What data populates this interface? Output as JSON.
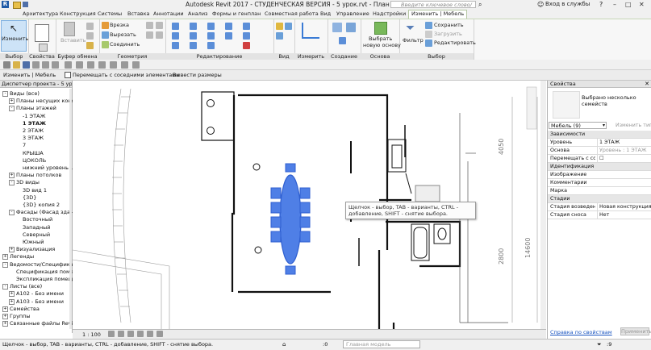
{
  "titlebar": {
    "title": "Autodesk Revit 2017 - СТУДЕНЧЕСКАЯ ВЕРСИЯ -  5 урок.rvt - План этажа: 1 ЭТАЖ",
    "search_placeholder": "Введите ключевое слово/фразу",
    "login": "Вход в службы"
  },
  "tabs": [
    "Архитектура",
    "Конструкция",
    "Системы",
    "Вставка",
    "Аннотации",
    "Анализ",
    "Формы и генплан",
    "Совместная работа",
    "Вид",
    "Управление",
    "Надстройки",
    "Изменить | Мебель"
  ],
  "active_tab_index": 11,
  "ribbon": {
    "modify_label": "Изменить",
    "select_group": "Выбор",
    "properties_group": "Свойства",
    "clipboard_insert": "Вставить",
    "clipboard_group": "Буфер обмена",
    "geometry_cut": "Врезка",
    "geometry_trim": "Вырезать",
    "geometry_join": "Соединить",
    "geometry_group": "Геометрия",
    "modify_group": "Редактирование",
    "view_group": "Вид",
    "measure_group": "Измерить",
    "create_group": "Создание",
    "pick_host_line1": "Выбрать",
    "pick_host_line2": "новую основу",
    "host_group": "Основа",
    "filter": "Фильтр",
    "save_sel": "Сохранить",
    "load_sel": "Загрузить",
    "edit_sel": "Редактировать",
    "selection_group": "Выбор"
  },
  "optbar": {
    "context": "Изменить | Мебель",
    "move_with_nearby": "Перемещать с соседними элементами",
    "free_dimensions": "Вывести размеры"
  },
  "project_browser": {
    "header": "Диспетчер проекта - 5 урок.rvt",
    "items": [
      {
        "label": "Виды (все)",
        "indent": 0,
        "exp": "-"
      },
      {
        "label": "Планы несущих констр",
        "indent": 1,
        "exp": "+"
      },
      {
        "label": "Планы этажей",
        "indent": 1,
        "exp": "-"
      },
      {
        "label": "-1 ЭТАЖ",
        "indent": 2
      },
      {
        "label": "1 ЭТАЖ",
        "indent": 2,
        "bold": true
      },
      {
        "label": "2 ЭТАЖ",
        "indent": 2
      },
      {
        "label": "3 ЭТАЖ",
        "indent": 2
      },
      {
        "label": "7",
        "indent": 2
      },
      {
        "label": "КРЫША",
        "indent": 2
      },
      {
        "label": "ЦОКОЛЬ",
        "indent": 2
      },
      {
        "label": "нижний уровень цок",
        "indent": 2
      },
      {
        "label": "Планы потолков",
        "indent": 1,
        "exp": "+"
      },
      {
        "label": "3D виды",
        "indent": 1,
        "exp": "-"
      },
      {
        "label": "3D вид 1",
        "indent": 2
      },
      {
        "label": "{3D}",
        "indent": 2
      },
      {
        "label": "{3D} копия 2",
        "indent": 2
      },
      {
        "label": "Фасады (Фасад здания",
        "indent": 1,
        "exp": "-"
      },
      {
        "label": "Восточный",
        "indent": 2
      },
      {
        "label": "Западный",
        "indent": 2
      },
      {
        "label": "Северный",
        "indent": 2
      },
      {
        "label": "Южный",
        "indent": 2
      },
      {
        "label": "Визуализация",
        "indent": 1,
        "exp": "+"
      },
      {
        "label": "Легенды",
        "indent": 0,
        "exp": "+"
      },
      {
        "label": "Ведомости/Спецификац",
        "indent": 0,
        "exp": "-"
      },
      {
        "label": "Спецификация помеще",
        "indent": 1
      },
      {
        "label": "Экспликация помещен",
        "indent": 1
      },
      {
        "label": "Листы (все)",
        "indent": 0,
        "exp": "-"
      },
      {
        "label": "A102 - Без имени",
        "indent": 1,
        "exp": "+"
      },
      {
        "label": "A103 - Без имени",
        "indent": 1,
        "exp": "+"
      },
      {
        "label": "Семейства",
        "indent": 0,
        "exp": "+"
      },
      {
        "label": "Группы",
        "indent": 0,
        "exp": "+"
      },
      {
        "label": "Связанные файлы Revit",
        "indent": 0,
        "exp": "+"
      }
    ]
  },
  "canvas": {
    "scale": "1 : 100",
    "dim_4050": "4050",
    "dim_2800": "2800",
    "dim_14600": "14600"
  },
  "tooltip": "Щелчок - выбор, TAB - варианты, CTRL - добавление, SHIFT - снятие выбора.",
  "properties": {
    "header": "Свойства",
    "type_desc": "Выбрано несколько семейств",
    "selector": "Мебель (9)",
    "edit_type": "Изменить тип",
    "rows": [
      {
        "k": "Зависимости",
        "sec": true
      },
      {
        "k": "Уровень",
        "v": "1 ЭТАЖ"
      },
      {
        "k": "Основа",
        "v": "Уровень : 1 ЭТАЖ",
        "grey": true
      },
      {
        "k": "Перемещать с со...",
        "v": "☐"
      },
      {
        "k": "Идентификация",
        "sec": true
      },
      {
        "k": "Изображение",
        "v": ""
      },
      {
        "k": "Комментарии",
        "v": ""
      },
      {
        "k": "Марка",
        "v": ""
      },
      {
        "k": "Стадии",
        "sec": true
      },
      {
        "k": "Стадия возведения",
        "v": "Новая конструкция"
      },
      {
        "k": "Стадия сноса",
        "v": "Нет"
      }
    ],
    "help_link": "Справка по свойствам",
    "apply": "Применить"
  },
  "status": {
    "hint": "Щелчок - выбор, TAB - варианты, CTRL - добавление, SHIFT - снятие выбора.",
    "zero": ":0",
    "model": "Главная модель"
  },
  "colors": {
    "ribbon_accent": "#b5c7a2",
    "selection_blue": "#2f5fd0",
    "selection_fill": "#4f7fe6"
  }
}
